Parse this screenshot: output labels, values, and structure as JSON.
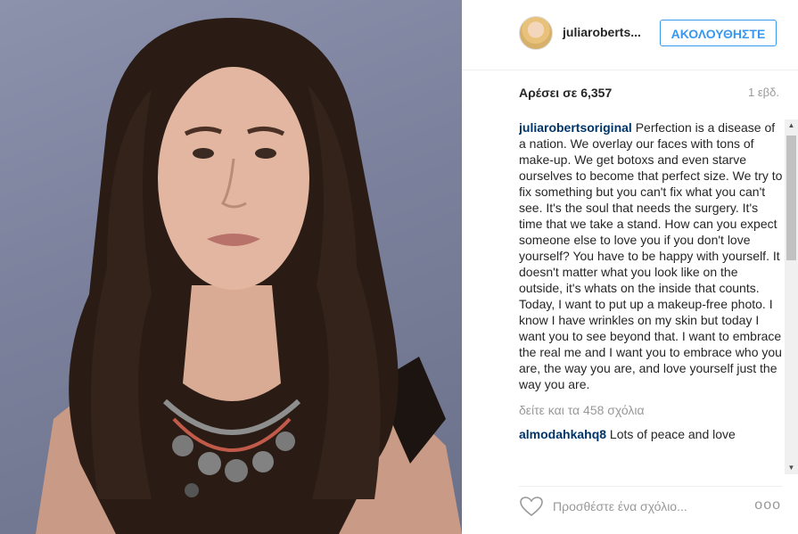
{
  "header": {
    "username": "juliarobertsoriginal",
    "username_display": "juliaroberts...",
    "follow_label": "ΑΚΟΛΟΥΘΗΣΤΕ"
  },
  "stats": {
    "likes_text": "Αρέσει σε 6,357",
    "time_ago": "1 εβδ."
  },
  "caption": {
    "user": "juliarobertsoriginal",
    "text": "Perfection is a disease of a nation. We overlay our faces with tons of make-up. We get botoxs and even starve ourselves to become that perfect size. We try to fix something but you can't fix what you can't see. It's the soul that needs the surgery. It's time that we take a stand. How can you expect someone else to love you if you don't love yourself? You have to be happy with yourself. It doesn't matter what you look like on the outside, it's whats on the inside that counts. Today, I want to put up a makeup-free photo. I know I have wrinkles on my skin but today I want you to see beyond that. I want to embrace the real me and I want you to embrace who you are, the way you are, and love yourself just the way you are."
  },
  "view_all_comments": "δείτε και τα 458 σχόλια",
  "comments": [
    {
      "user": "almodahkahq8",
      "text": "Lots of peace and love"
    }
  ],
  "comment_bar": {
    "placeholder": "Προσθέστε ένα σχόλιο...",
    "more_label": "ooo"
  },
  "icons": {
    "like": "heart-outline-icon",
    "scroll_up": "triangle-up-icon",
    "scroll_down": "triangle-down-icon"
  },
  "colors": {
    "accent": "#3897f0",
    "username": "#003569",
    "muted": "#999999"
  }
}
